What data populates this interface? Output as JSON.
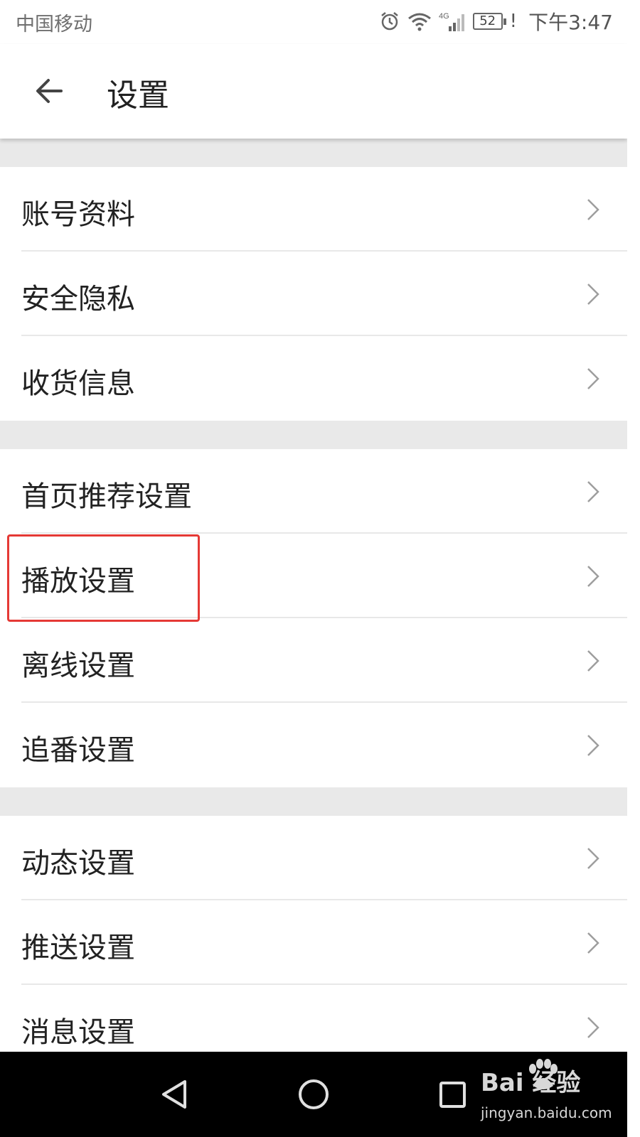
{
  "status_bar": {
    "carrier": "中国移动",
    "network_label": "4G",
    "battery_level": "52",
    "alert_mark": "!",
    "time": "下午3:47"
  },
  "app_bar": {
    "title": "设置",
    "back_icon": "arrow-left-icon"
  },
  "groups": [
    {
      "items": [
        {
          "label": "账号资料"
        },
        {
          "label": "安全隐私"
        },
        {
          "label": "收货信息"
        }
      ]
    },
    {
      "items": [
        {
          "label": "首页推荐设置"
        },
        {
          "label": "播放设置"
        },
        {
          "label": "离线设置"
        },
        {
          "label": "追番设置"
        }
      ]
    },
    {
      "items": [
        {
          "label": "动态设置"
        },
        {
          "label": "推送设置"
        },
        {
          "label": "消息设置"
        }
      ]
    }
  ],
  "highlighted_item": "播放设置",
  "colors": {
    "highlight_border": "#e53935",
    "section_gap": "#e9e9e9",
    "nav_bar": "#000000"
  },
  "nav_bar": {
    "buttons": [
      "back-triangle-icon",
      "home-circle-icon",
      "recents-square-icon"
    ]
  },
  "watermark": {
    "brand": "Bai  经验",
    "url": "jingyan.baidu.com"
  }
}
